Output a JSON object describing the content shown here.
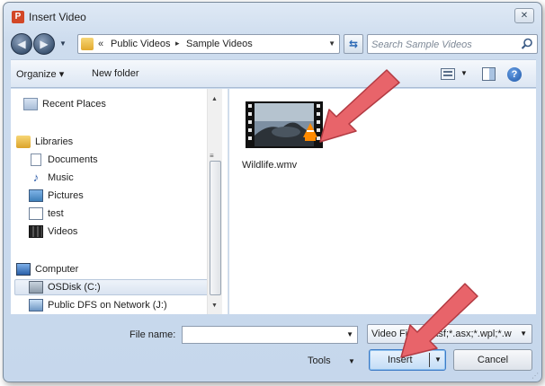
{
  "window": {
    "title": "Insert Video",
    "app_icon_letter": "P",
    "close_glyph": "✕"
  },
  "address": {
    "lead": "«",
    "crumbs": [
      "Public Videos",
      "Sample Videos"
    ],
    "separator": "▸"
  },
  "search": {
    "placeholder": "Search Sample Videos"
  },
  "toolbar": {
    "organize_label": "Organize ▾",
    "new_folder_label": "New folder",
    "help_glyph": "?"
  },
  "nav": {
    "items": [
      {
        "label": "Recent Places",
        "icon": "recent-places-icon"
      },
      {
        "label": "Libraries",
        "icon": "libraries-icon"
      },
      {
        "label": "Documents",
        "icon": "documents-icon"
      },
      {
        "label": "Music",
        "icon": "music-icon"
      },
      {
        "label": "Pictures",
        "icon": "pictures-icon"
      },
      {
        "label": "test",
        "icon": "test-icon"
      },
      {
        "label": "Videos",
        "icon": "videos-icon"
      },
      {
        "label": "Computer",
        "icon": "computer-icon"
      },
      {
        "label": "OSDisk (C:)",
        "icon": "disk-icon"
      },
      {
        "label": "Public DFS on Network (J:)",
        "icon": "network-drive-icon"
      }
    ],
    "selected": "OSDisk (C:)"
  },
  "files": [
    {
      "name": "Wildlife.wmv",
      "icon": "video-thumbnail-icon"
    }
  ],
  "bottom": {
    "file_name_label": "File name:",
    "file_name_value": "",
    "filter_text": "Video Files (*.asf;*.asx;*.wpl;*.w",
    "tools_label": "Tools",
    "insert_label": "Insert",
    "cancel_label": "Cancel"
  },
  "annotation_color": "#e8646a"
}
